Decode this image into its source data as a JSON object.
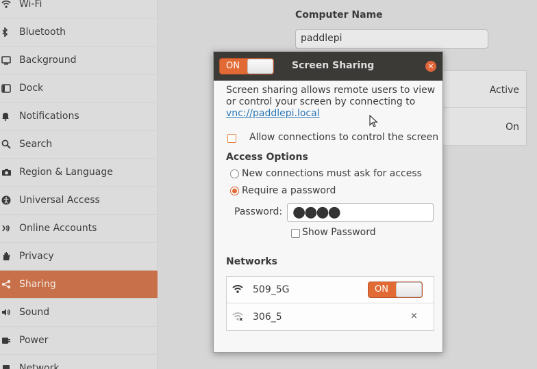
{
  "sidebar": {
    "items": [
      {
        "label": "Wi-Fi",
        "icon": "wifi-icon"
      },
      {
        "label": "Bluetooth",
        "icon": "bluetooth-icon"
      },
      {
        "label": "Background",
        "icon": "background-icon"
      },
      {
        "label": "Dock",
        "icon": "dock-icon"
      },
      {
        "label": "Notifications",
        "icon": "bell-icon"
      },
      {
        "label": "Search",
        "icon": "search-icon"
      },
      {
        "label": "Region & Language",
        "icon": "camera-icon"
      },
      {
        "label": "Universal Access",
        "icon": "accessibility-icon"
      },
      {
        "label": "Online Accounts",
        "icon": "online-accounts-icon"
      },
      {
        "label": "Privacy",
        "icon": "hand-icon"
      },
      {
        "label": "Sharing",
        "icon": "share-icon",
        "active": true
      },
      {
        "label": "Sound",
        "icon": "speaker-icon"
      },
      {
        "label": "Power",
        "icon": "power-icon"
      },
      {
        "label": "Network",
        "icon": "network-icon"
      }
    ]
  },
  "main": {
    "computer_name_label": "Computer Name",
    "computer_name_value": "paddlepi",
    "services": [
      {
        "status": "Active"
      },
      {
        "status": "On"
      }
    ]
  },
  "dialog": {
    "title": "Screen Sharing",
    "toggle_label": "ON",
    "close_glyph": "×",
    "description_prefix": "Screen sharing allows remote users to view or control your screen by connecting to ",
    "description_link": "vnc://paddlepi.local",
    "allow_control_label": "Allow connections to control the screen",
    "access_options_heading": "Access Options",
    "radio_ask": "New connections must ask for access",
    "radio_password": "Require a password",
    "password_label": "Password:",
    "password_value": "●●●●",
    "show_password_label": "Show Password",
    "networks_heading": "Networks",
    "networks": [
      {
        "name": "509_5G",
        "toggle": "ON",
        "icon": "wifi-icon"
      },
      {
        "name": "306_5",
        "remove": "×",
        "icon": "wifi-disconnected-icon"
      }
    ]
  },
  "colors": {
    "accent": "#e16a35",
    "sidebar_active": "#c8704a",
    "dialog_header": "#3b3a37",
    "link": "#2a76b6"
  }
}
